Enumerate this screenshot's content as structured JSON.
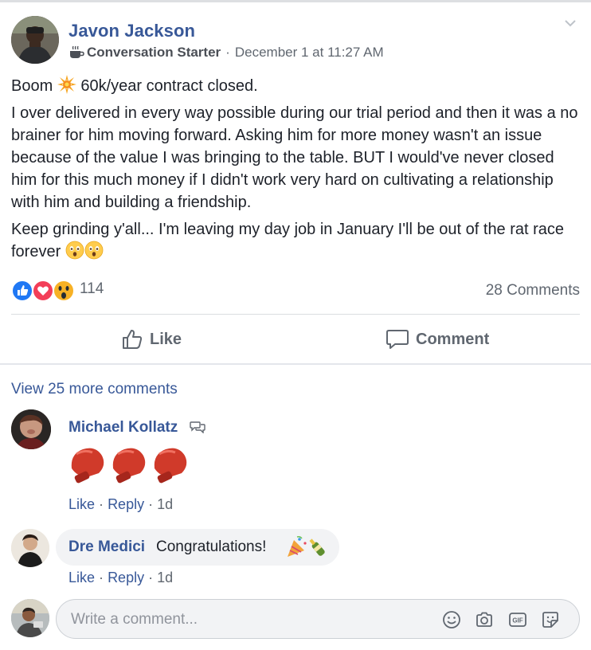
{
  "post": {
    "author": "Javon Jackson",
    "badge": "Conversation Starter",
    "separator": "·",
    "timestamp": "December 1 at 11:27 AM",
    "paragraph_1_before": "Boom",
    "paragraph_1_after": "60k/year contract closed.",
    "paragraph_2": "I over delivered in every way possible during our trial period and then it was a no brainer for him moving forward. Asking him for more money wasn't an issue because of the value I was bringing to the table. BUT I would've never closed him for this much money if I didn't work very hard on cultivating a relationship with him and building a friendship.",
    "paragraph_3": "Keep grinding y'all... I'm leaving my day job in January I'll be out of the rat race forever",
    "reaction_count": "114",
    "comments_count": "28 Comments",
    "icons": [
      "avatar",
      "coffee-cup-icon",
      "chevron-down-icon",
      "sparkle-emoji",
      "astonished-emoji",
      "like-reaction-icon",
      "love-reaction-icon",
      "wow-reaction-icon"
    ]
  },
  "actions": {
    "like_label": "Like",
    "comment_label": "Comment"
  },
  "comments": {
    "view_more": "View 25 more comments",
    "items": [
      {
        "author": "Michael Kollatz",
        "body_emoji": "boxing-glove x3",
        "like": "Like",
        "reply": "Reply",
        "sep": "·",
        "time": "1d"
      },
      {
        "author": "Dre Medici",
        "text": "Congratulations!",
        "like": "Like",
        "reply": "Reply",
        "sep": "·",
        "time": "1d"
      }
    ]
  },
  "composer": {
    "placeholder": "Write a comment...",
    "icons": [
      "smiley-icon",
      "camera-icon",
      "gif-icon",
      "sticker-icon"
    ]
  },
  "colors": {
    "link_blue": "#385898",
    "meta_gray": "#606770",
    "text": "#1d2129",
    "like_blue": "#2078f4",
    "love_red": "#f33e58",
    "wow_yellow": "#f7b125"
  }
}
